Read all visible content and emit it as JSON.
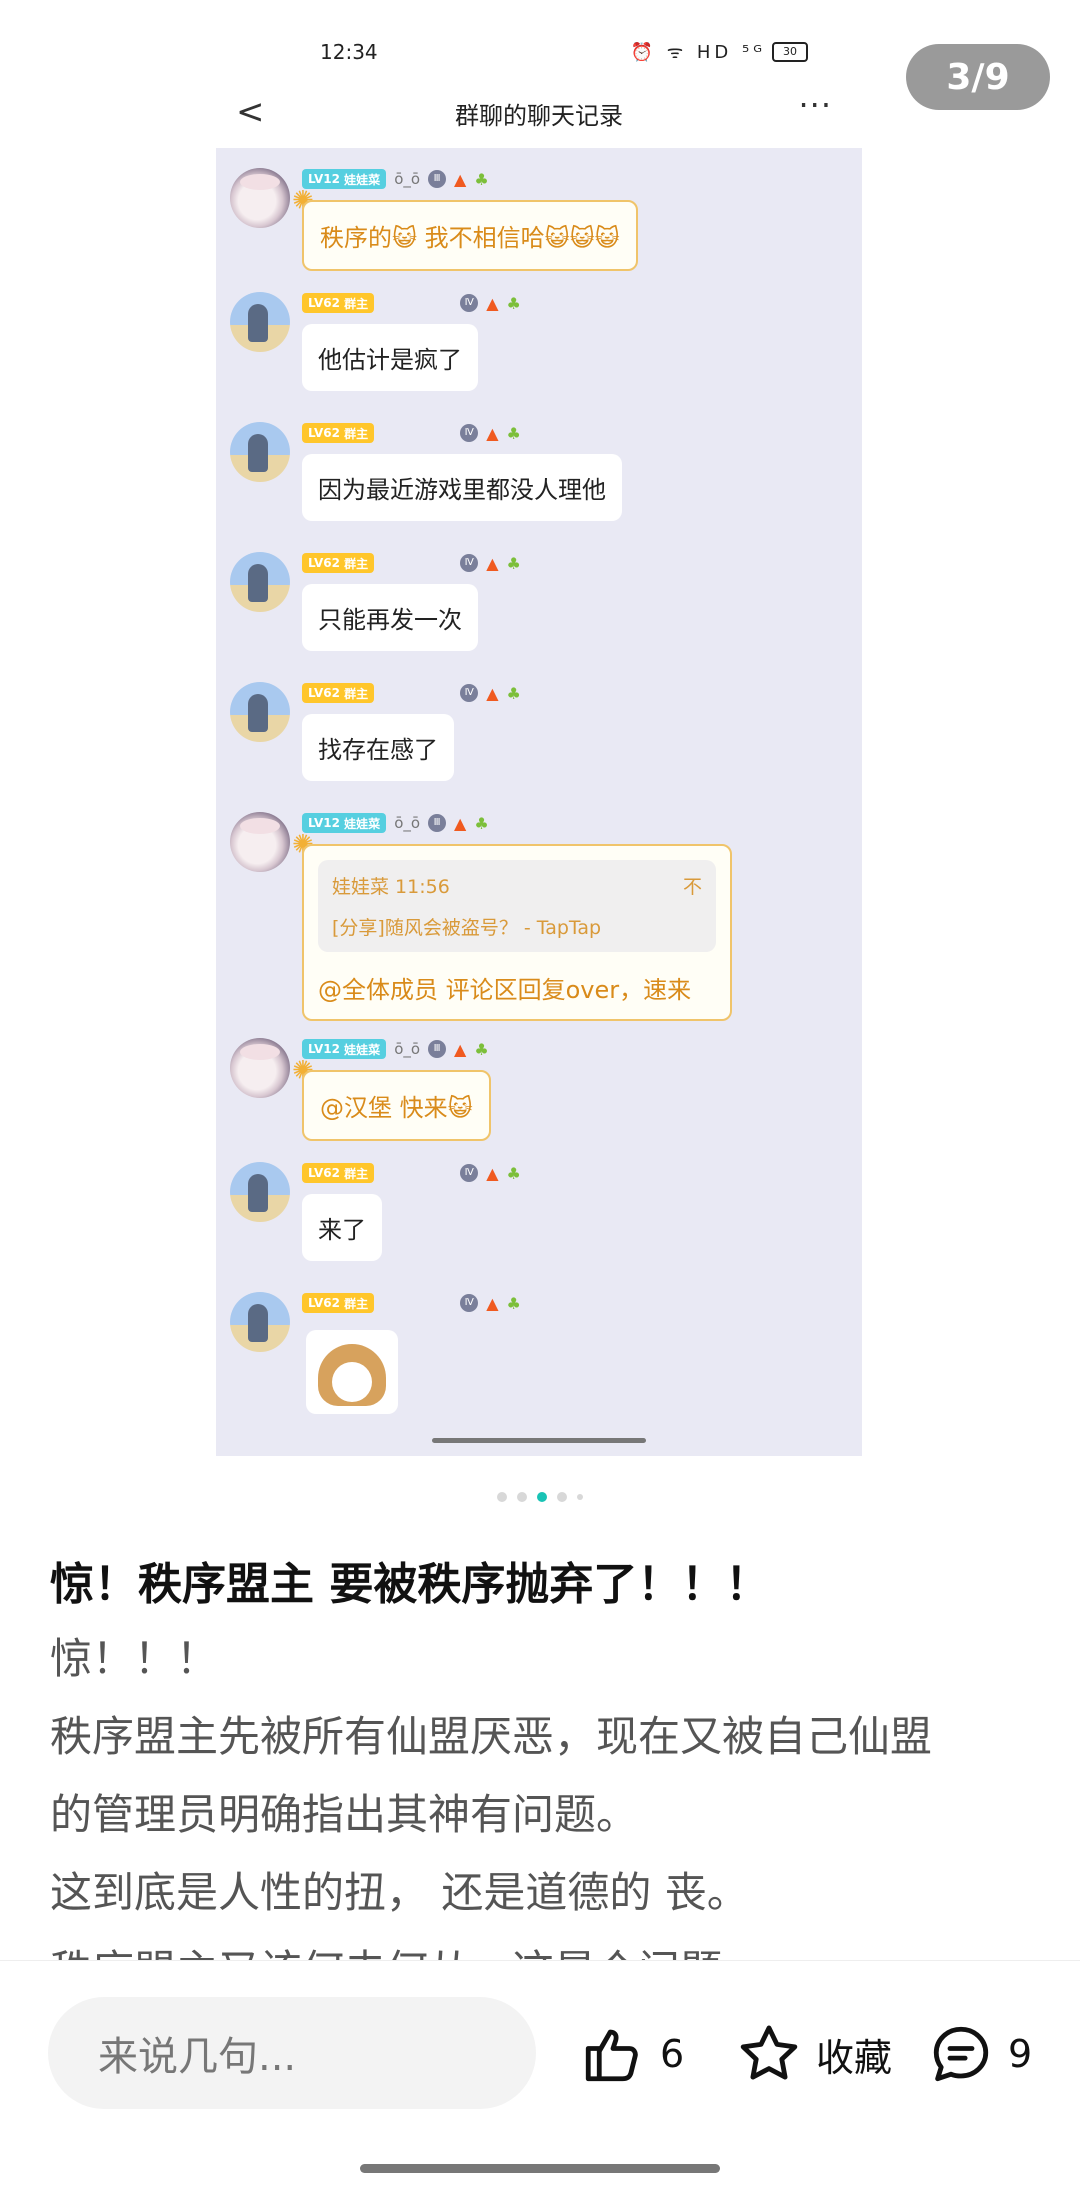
{
  "viewer": {
    "counter": "3/9"
  },
  "screenshot": {
    "status": {
      "time": "12:34",
      "icons": "⏰ ᯤ HD ⁵ᴳ",
      "battery": "30"
    },
    "nav": {
      "back": "<",
      "title": "群聊的聊天记录",
      "more": "···"
    },
    "messages": [
      {
        "sender_level": "LV12",
        "sender_name": "娃娃菜",
        "face": "ō_ō",
        "text": "秩序的😺 我不相信哈😺😺😺"
      },
      {
        "sender_level": "LV62",
        "sender_name": "群主",
        "text": "他估计是疯了"
      },
      {
        "sender_level": "LV62",
        "sender_name": "群主",
        "text": "因为最近游戏里都没人理他"
      },
      {
        "sender_level": "LV62",
        "sender_name": "群主",
        "text": "只能再发一次"
      },
      {
        "sender_level": "LV62",
        "sender_name": "群主",
        "text": "找存在感了"
      },
      {
        "sender_level": "LV12",
        "sender_name": "娃娃菜",
        "face": "ō_ō",
        "quote_author": "娃娃菜 11:56",
        "quote_icon": "不",
        "quote_text": "[分享]随风会被盗号？ - TapTap",
        "text": "@全体成员 评论区回复over，速来"
      },
      {
        "sender_level": "LV12",
        "sender_name": "娃娃菜",
        "face": "ō_ō",
        "text": "@汉堡 快来😺"
      },
      {
        "sender_level": "LV62",
        "sender_name": "群主",
        "text": "来了"
      },
      {
        "sender_level": "LV62",
        "sender_name": "群主",
        "text": ""
      }
    ]
  },
  "post": {
    "title": "惊！秩序盟主 要被秩序抛弃了！！！",
    "body_lines": [
      "惊！！！",
      "秩序盟主先被所有仙盟厌恶，现在又被自己仙盟",
      "的管理员明确指出其神有问题。",
      "这到底是人性的扭， 还是道德的 丧。",
      "秩序盟主又该何去何从，这是个问题"
    ]
  },
  "bottom_bar": {
    "comment_placeholder": "来说几句...",
    "like_count": "6",
    "favorite_label": "收藏",
    "comment_count": "9"
  },
  "colors": {
    "accent": "#19c3b5",
    "chat_bg": "#e9e9f4",
    "level_owner": "#ffc62b",
    "level_member": "#56cfe0"
  }
}
